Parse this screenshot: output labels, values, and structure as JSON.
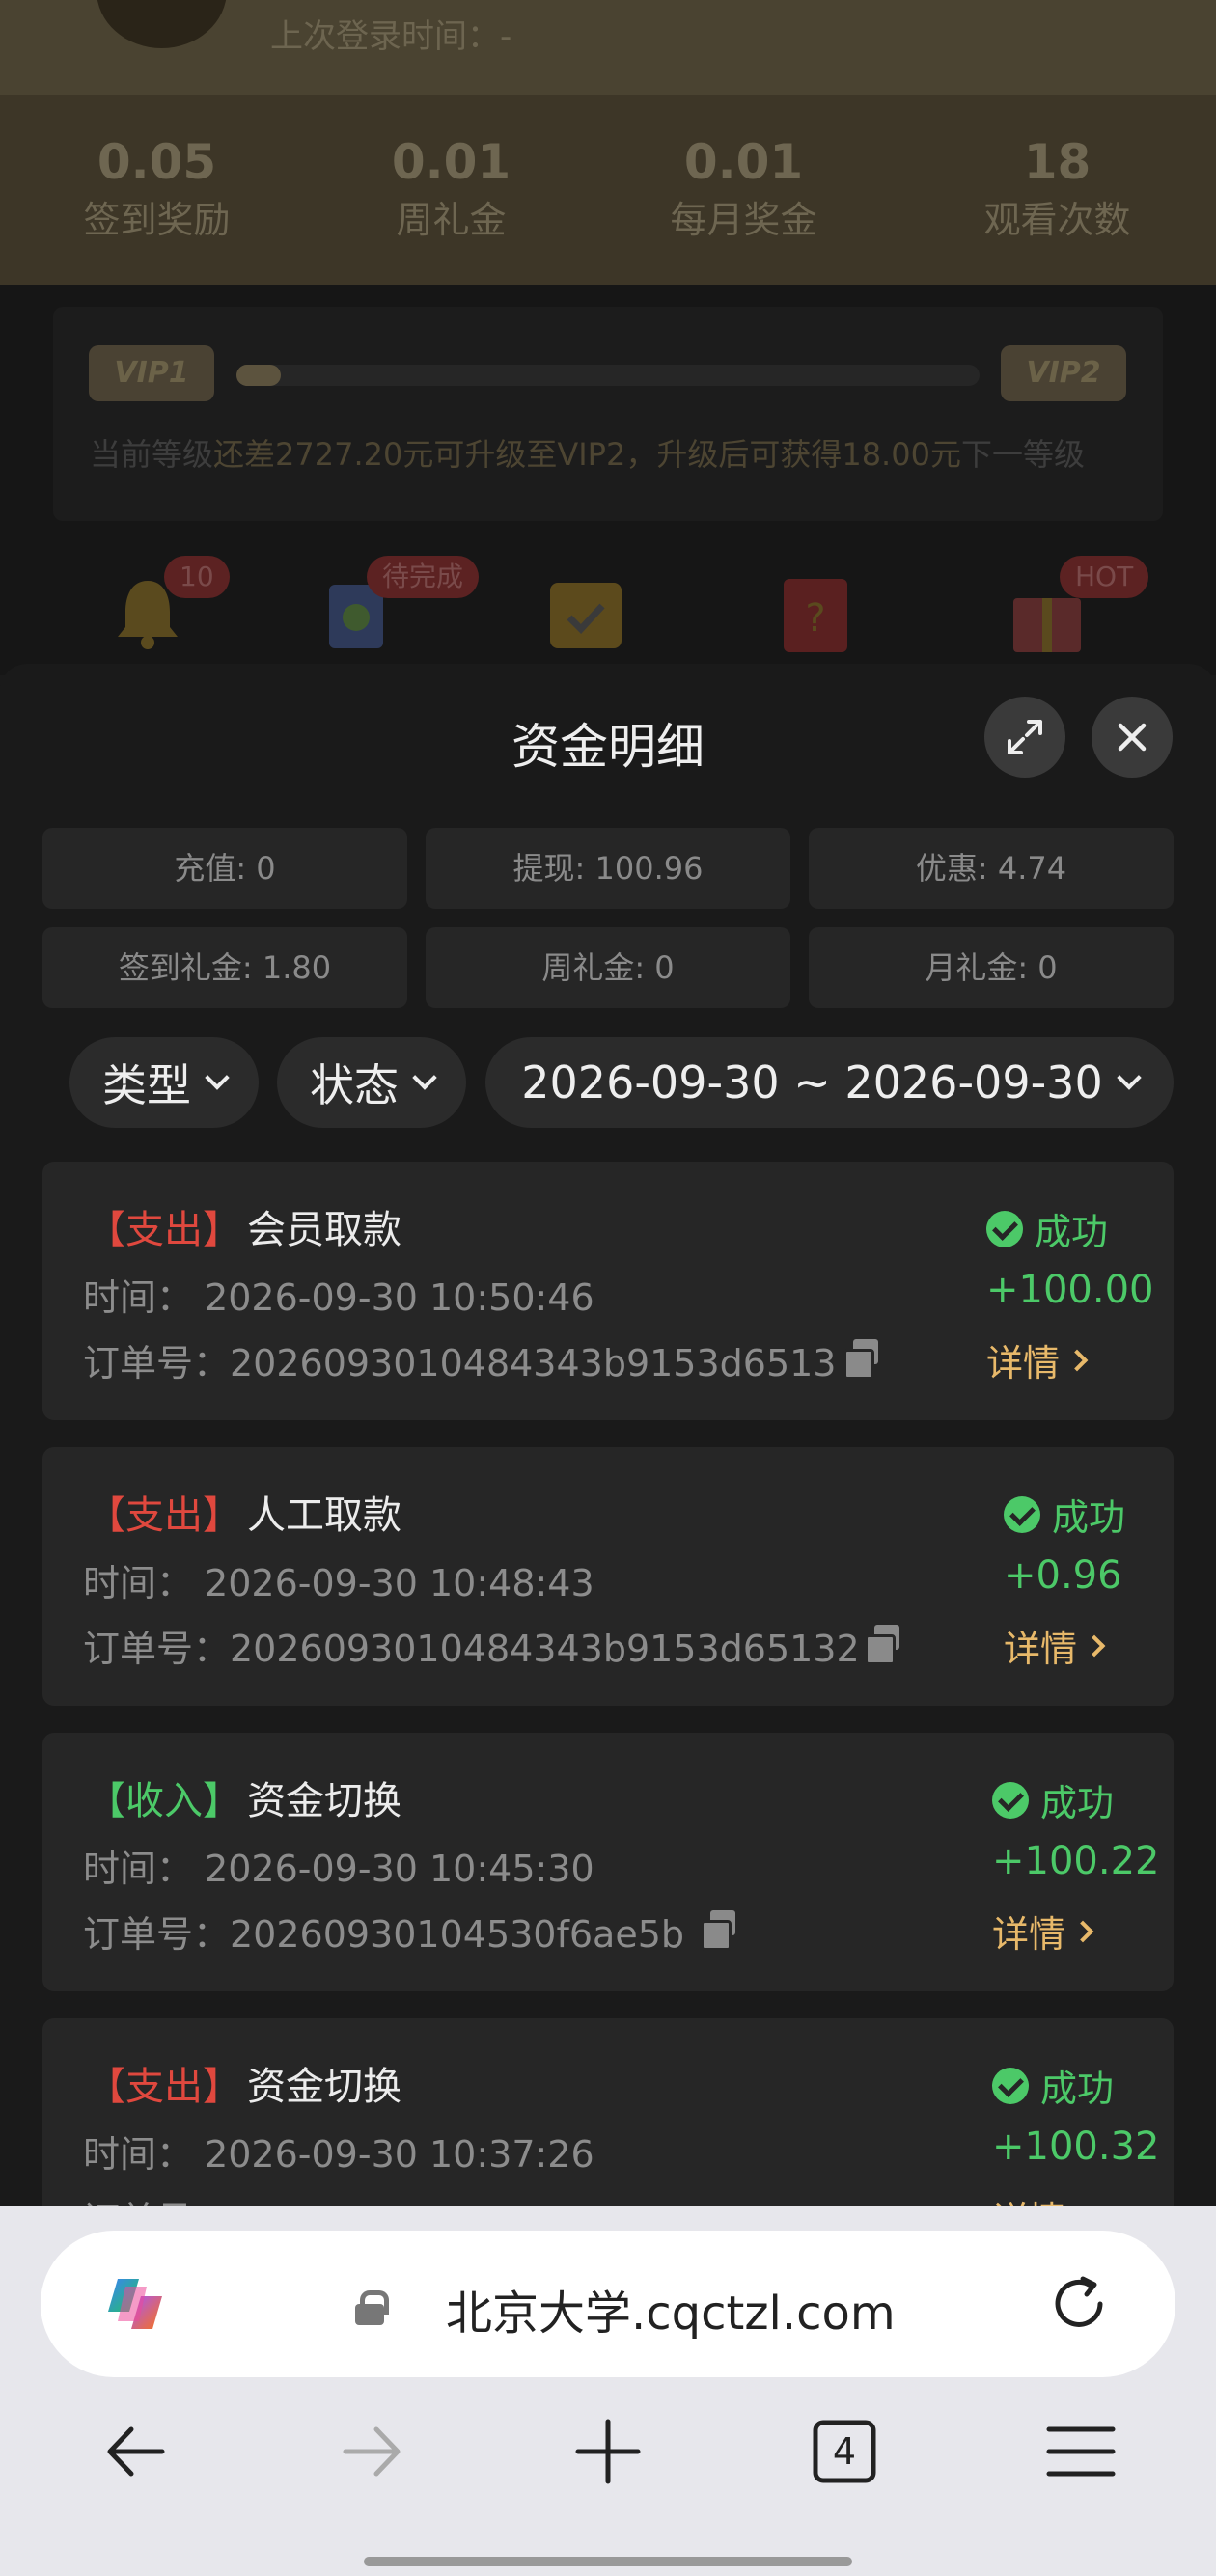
{
  "background": {
    "last_login": "上次登录时间：-",
    "stats": [
      {
        "value": "0.05",
        "label": "签到奖励"
      },
      {
        "value": "0.01",
        "label": "周礼金"
      },
      {
        "value": "0.01",
        "label": "每月奖金"
      },
      {
        "value": "18",
        "label": "观看次数"
      }
    ],
    "vip": {
      "current": "VIP1",
      "next": "VIP2",
      "progress": 0.06,
      "text_prefix": "当前等级",
      "text_highlight": "还差2727.20元可升级至VIP2，升级后可获得18.00元",
      "text_suffix": "下一等级"
    },
    "icon_badges": {
      "notifications": "10",
      "tasks": "待完成",
      "gifts": "HOT"
    }
  },
  "sheet": {
    "title": "资金明细",
    "summary": [
      "充值: 0",
      "提现: 100.96",
      "优惠: 4.74",
      "签到礼金: 1.80",
      "周礼金: 0",
      "月礼金: 0"
    ],
    "filters": {
      "type": "类型",
      "status": "状态",
      "date_range": "2026-09-30 ~ 2026-09-30"
    },
    "records": [
      {
        "tag": "【支出】",
        "kind": "out",
        "name": "会员取款",
        "time": "时间：  2026-09-30 10:50:46",
        "order": "订单号：2026093010484343b9153d6513",
        "status": "成功",
        "amount": "+100.00",
        "detail": "详情"
      },
      {
        "tag": "【支出】",
        "kind": "out",
        "name": "人工取款",
        "time": "时间：  2026-09-30 10:48:43",
        "order": "订单号：2026093010484343b9153d65132",
        "status": "成功",
        "amount": "+0.96",
        "detail": "详情"
      },
      {
        "tag": "【收入】",
        "kind": "in",
        "name": "资金切换",
        "time": "时间：  2026-09-30 10:45:30",
        "order": "订单号：20260930104530f6ae5b",
        "status": "成功",
        "amount": "+100.22",
        "detail": "详情"
      },
      {
        "tag": "【支出】",
        "kind": "out",
        "name": "资金切换",
        "time": "时间：  2026-09-30 10:37:26",
        "order": "订单号：",
        "status": "成功",
        "amount": "+100.32",
        "detail": "详情"
      }
    ]
  },
  "browser": {
    "url": "北京大学.cqctzl.com",
    "tab_count": "4",
    "icons": [
      "copilot-icon",
      "lock-icon",
      "reload-icon",
      "back-icon",
      "forward-icon",
      "new-tab-icon",
      "tabs-icon",
      "menu-icon"
    ]
  },
  "colors": {
    "success": "#4cc968",
    "expense": "#e0483e",
    "income": "#4cc968",
    "detail_link": "#e8b96a"
  }
}
